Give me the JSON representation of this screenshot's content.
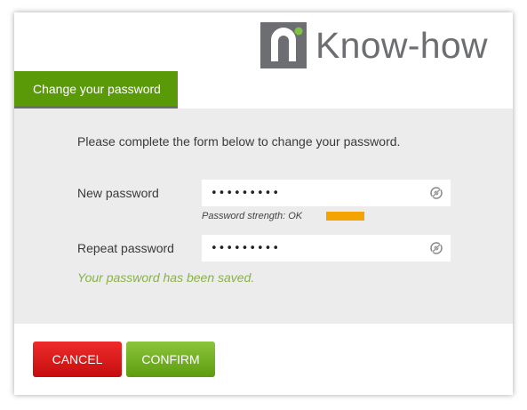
{
  "brand": {
    "name": "Know-how",
    "logo_icon": "n-dot-logo-icon",
    "logo_gray": "#6c6e72",
    "logo_green": "#7dc242"
  },
  "tab": {
    "label": "Change your password",
    "color": "#5a9a09"
  },
  "form": {
    "intro": "Please complete the form below to change your password.",
    "new_password": {
      "label": "New password",
      "value": "•••••••••",
      "icon": "reveal-password-icon"
    },
    "strength": {
      "text": "Password strength: OK",
      "level": 0.6,
      "color": "#f5a300"
    },
    "repeat_password": {
      "label": "Repeat password",
      "value": "•••••••••",
      "icon": "reveal-password-icon"
    },
    "status_message": "Your password has been saved.",
    "status_color": "#8ab14a"
  },
  "buttons": {
    "cancel_label": "CANCEL",
    "confirm_label": "CONFIRM",
    "cancel_color": "#d81b1b",
    "confirm_color": "#6fae1f"
  }
}
